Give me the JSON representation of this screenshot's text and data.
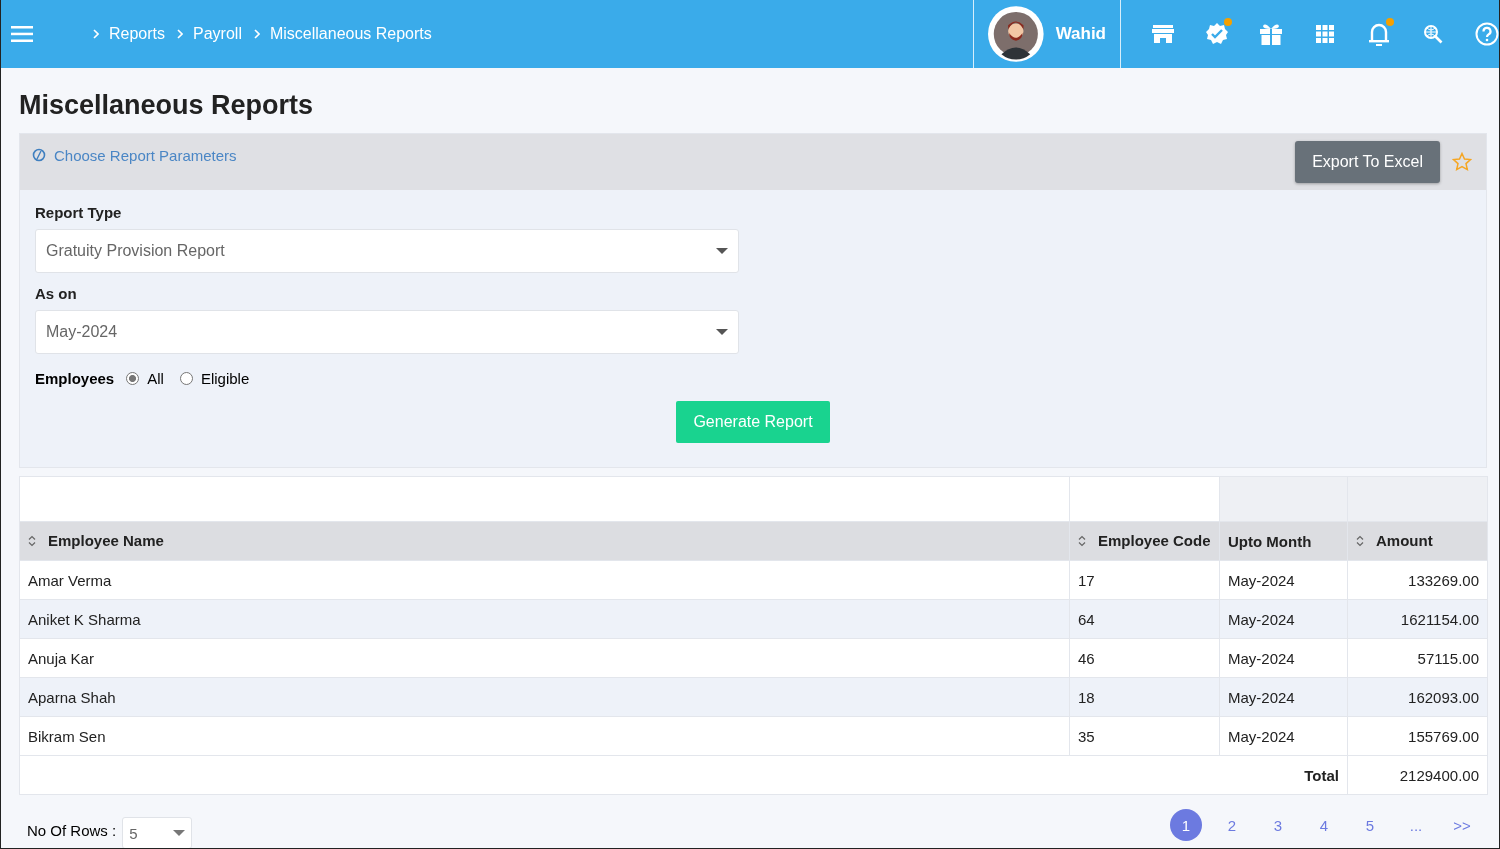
{
  "topbar": {
    "breadcrumbs": [
      "Reports",
      "Payroll",
      "Miscellaneous Reports"
    ],
    "user": {
      "name": "Wahid"
    },
    "icons": [
      {
        "kind": "store",
        "dot": false
      },
      {
        "kind": "verified",
        "dot": true
      },
      {
        "kind": "gift",
        "dot": false
      },
      {
        "kind": "apps",
        "dot": false
      },
      {
        "kind": "bell",
        "dot": true
      },
      {
        "kind": "globe-search",
        "dot": false
      },
      {
        "kind": "help",
        "dot": false
      }
    ]
  },
  "page_title": "Miscellaneous Reports",
  "parameters": {
    "header": "Choose Report Parameters",
    "export_button": "Export To Excel",
    "fields": [
      {
        "label": "Report Type",
        "value": "Gratuity Provision Report"
      },
      {
        "label": "As on",
        "value": "May-2024"
      }
    ],
    "employees": {
      "label": "Employees",
      "options": [
        {
          "label": "All",
          "selected": true
        },
        {
          "label": "Eligible",
          "selected": false
        }
      ]
    },
    "generate_button": "Generate Report"
  },
  "table": {
    "columns": [
      {
        "label": "Employee Name",
        "sortable": true
      },
      {
        "label": "Employee Code",
        "sortable": true
      },
      {
        "label": "Upto Month",
        "sortable": false
      },
      {
        "label": "Amount",
        "sortable": true
      }
    ],
    "rows": [
      [
        "Amar Verma",
        "17",
        "May-2024",
        "133269.00"
      ],
      [
        "Aniket K Sharma",
        "64",
        "May-2024",
        "1621154.00"
      ],
      [
        "Anuja Kar",
        "46",
        "May-2024",
        "57115.00"
      ],
      [
        "Aparna Shah",
        "18",
        "May-2024",
        "162093.00"
      ],
      [
        "Bikram Sen",
        "35",
        "May-2024",
        "155769.00"
      ]
    ],
    "total_label": "Total",
    "total": "2129400.00"
  },
  "footer": {
    "rows_label": "No Of Rows :",
    "rows_value": "5",
    "pages": [
      {
        "label": "1",
        "selected": true
      },
      {
        "label": "2",
        "selected": false
      },
      {
        "label": "3",
        "selected": false
      },
      {
        "label": "4",
        "selected": false
      },
      {
        "label": "5",
        "selected": false
      },
      {
        "label": "...",
        "selected": false
      },
      {
        "label": ">>",
        "selected": false
      }
    ]
  }
}
